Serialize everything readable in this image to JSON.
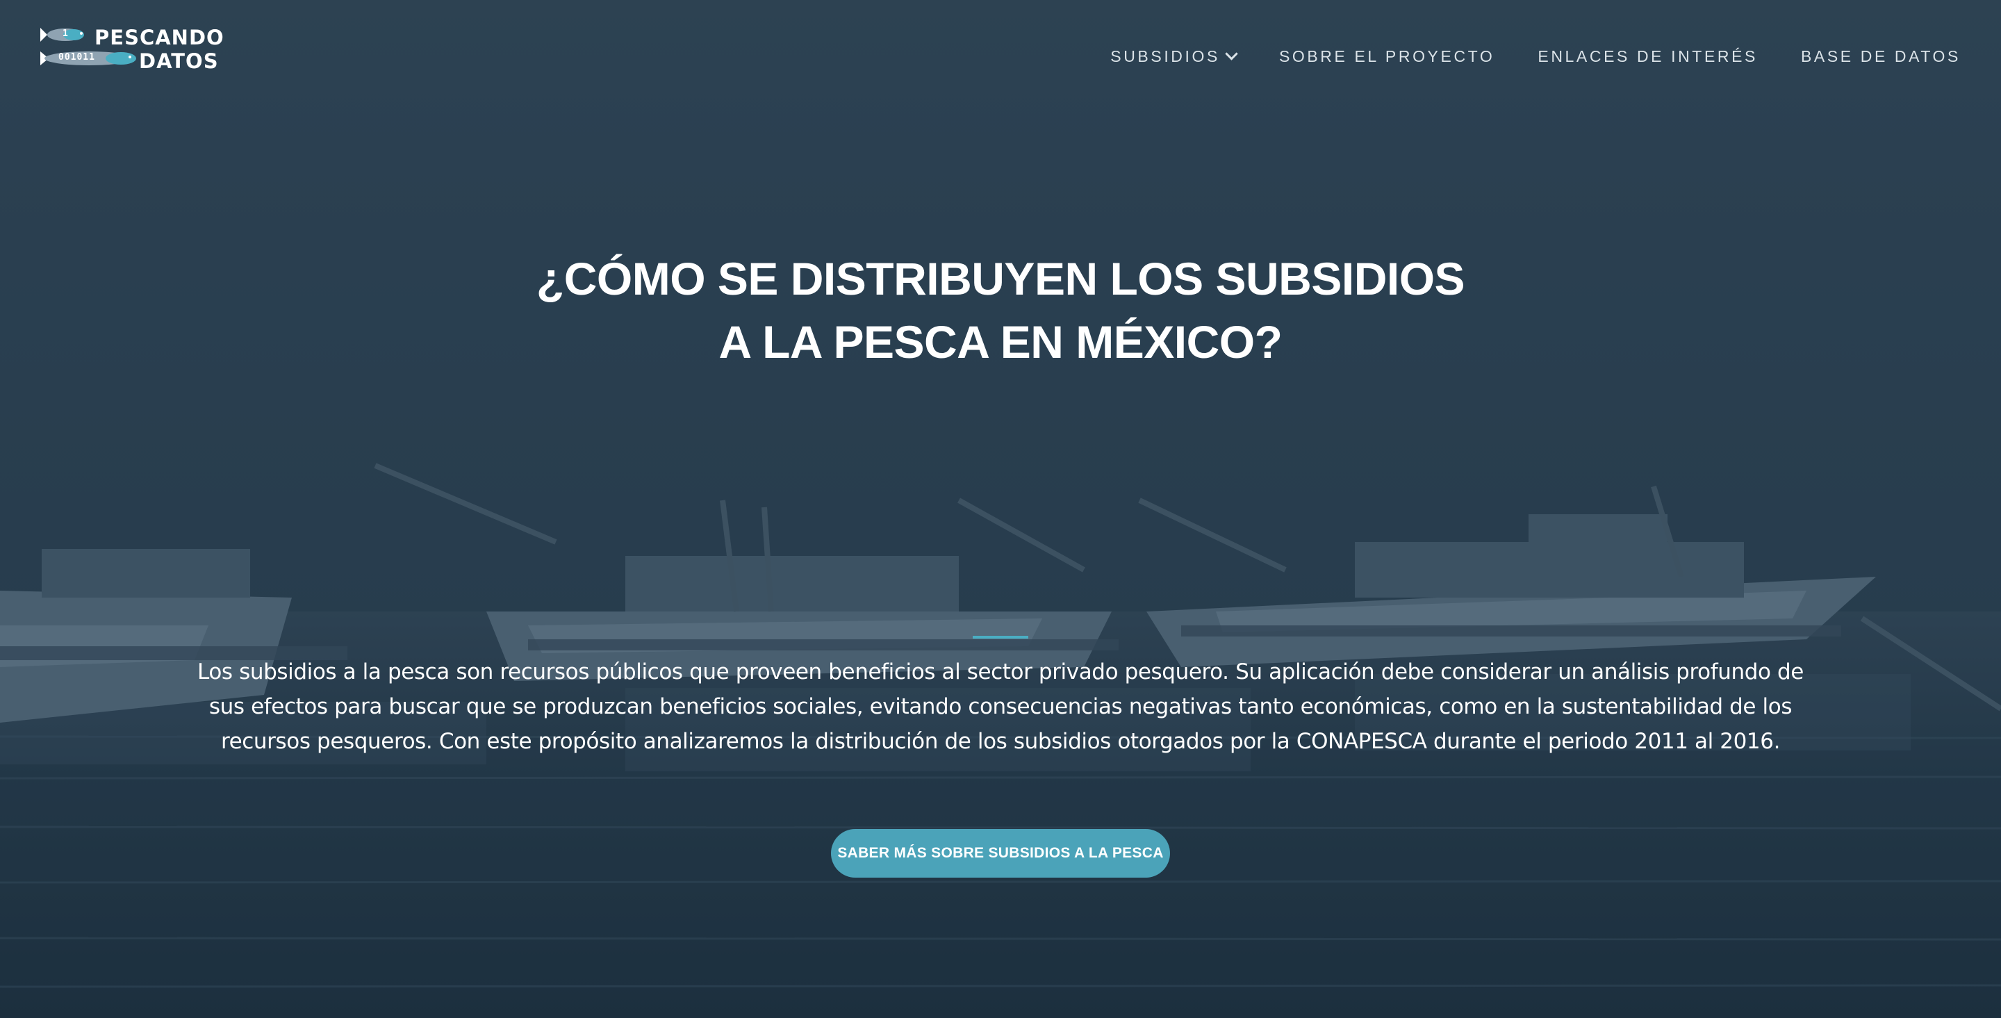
{
  "brand": {
    "line1": "PESCANDO",
    "line2": "DATOS",
    "fish1_code": "1",
    "fish2_code": "001011",
    "accent": "#4aaec3"
  },
  "nav": {
    "items": [
      {
        "label": "SUBSIDIOS",
        "has_dropdown": true
      },
      {
        "label": "SOBRE EL PROYECTO"
      },
      {
        "label": "ENLACES DE INTERÉS"
      },
      {
        "label": "BASE DE DATOS"
      }
    ]
  },
  "hero": {
    "title_line1": "¿CÓMO SE DISTRIBUYEN LOS SUBSIDIOS",
    "title_line2": "A LA PESCA EN MÉXICO?",
    "description": "Los subsidios a la pesca son recursos públicos que proveen beneficios al sector privado pesquero. Su aplicación debe considerar un análisis profundo de sus efectos para buscar que se produzcan beneficios sociales, evitando consecuencias negativas tanto económicas, como en la sustentabilidad de los recursos pesqueros. Con este propósito analizaremos la distribución de los subsidios otorgados por la CONAPESCA durante el periodo 2011 al 2016.",
    "cta_label": "SABER MÁS SOBRE SUBSIDIOS A LA PESCA",
    "cta_color": "#4ba3b9"
  }
}
